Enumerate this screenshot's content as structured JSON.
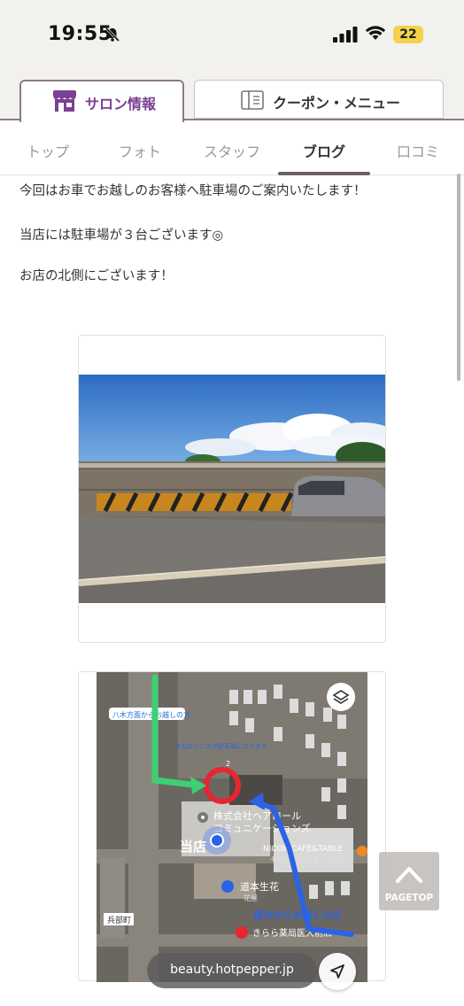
{
  "status_bar": {
    "time": "19:55",
    "battery": "22",
    "icons": [
      "bell-slash-icon",
      "signal-icon",
      "wifi-icon",
      "battery-icon"
    ]
  },
  "header_tabs": {
    "salon": {
      "label": "サロン情報",
      "icon": "shop-icon"
    },
    "coupon": {
      "label": "クーポン・メニュー",
      "icon": "menu-book-icon"
    }
  },
  "subnav": {
    "items": [
      "トップ",
      "フォト",
      "スタッフ",
      "ブログ",
      "口コミ"
    ],
    "active": "ブログ"
  },
  "article": {
    "lines": [
      "今回はお車でお越しのお客様へ駐車場のご案内いたします！",
      "当店には駐車場が３台ございます◎",
      "お店の北側にございます！"
    ]
  },
  "map": {
    "labels": {
      "route_north": "八木方面からお越しの方",
      "red_circle_note": "赤丸のところが駐車場になります",
      "number_2": "2",
      "company": "株式会社ヘアロール",
      "company_sub": "コミュニケーションズ",
      "cafe": "NICOR CAFE&TABLE",
      "cafe_sub": "それほど混んでいません",
      "shop": "当店",
      "flower": "道本生花",
      "flower_sub": "花屋",
      "route_south": "医大からお越しの方",
      "pharmacy": "きらら薬局医大前店",
      "town": "兵部町"
    }
  },
  "pagetop": {
    "label": "PAGETOP"
  },
  "browser": {
    "url": "beauty.hotpepper.jp"
  },
  "colors": {
    "accent_purple": "#7b3f93",
    "route_green": "#3ecf73",
    "route_blue": "#2b63e6",
    "marker_red": "#e8252f"
  }
}
